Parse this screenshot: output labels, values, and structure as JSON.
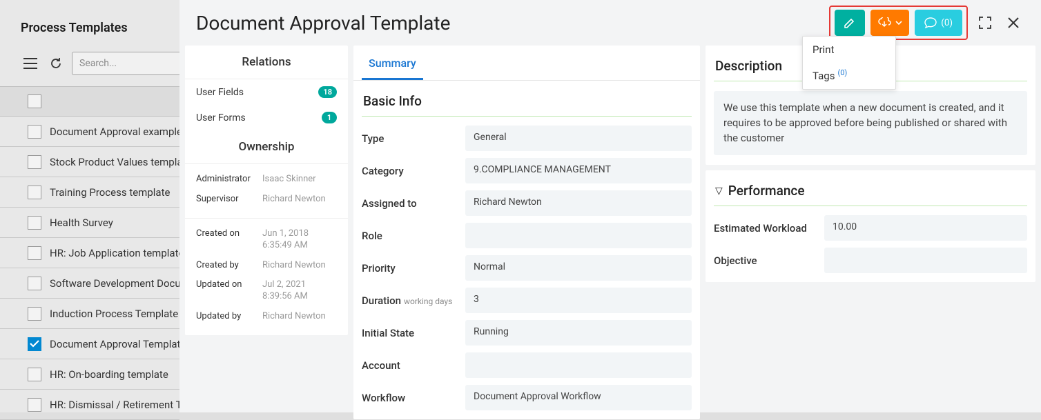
{
  "sidebar": {
    "title": "Process Templates",
    "search_placeholder": "Search...",
    "items": [
      {
        "label": "Document Approval example",
        "checked": false
      },
      {
        "label": "Stock Product Values template",
        "checked": false
      },
      {
        "label": "Training Process template",
        "checked": false
      },
      {
        "label": "Health Survey",
        "checked": false
      },
      {
        "label": "HR: Job Application template",
        "checked": false
      },
      {
        "label": "Software Development Document",
        "checked": false
      },
      {
        "label": "Induction Process Template",
        "checked": false
      },
      {
        "label": "Document Approval Template",
        "checked": true
      },
      {
        "label": "HR: On-boarding template",
        "checked": false
      },
      {
        "label": "HR: Dismissal / Retirement Template",
        "checked": false
      }
    ]
  },
  "main": {
    "title": "Document Approval Template",
    "chat_count": "(0)",
    "tabs": {
      "summary": "Summary"
    },
    "dropdown": {
      "print": "Print",
      "tags": "Tags",
      "tags_count": "(0)"
    }
  },
  "relations": {
    "header": "Relations",
    "items": [
      {
        "label": "User Fields",
        "count": "18"
      },
      {
        "label": "User Forms",
        "count": "1"
      }
    ]
  },
  "ownership": {
    "header": "Ownership",
    "rows": [
      {
        "label": "Administrator",
        "value": "Isaac Skinner"
      },
      {
        "label": "Supervisor",
        "value": "Richard Newton"
      }
    ],
    "rows2": [
      {
        "label": "Created on",
        "value": "Jun 1, 2018 6:35:49 AM"
      },
      {
        "label": "Created by",
        "value": "Richard Newton"
      },
      {
        "label": "Updated on",
        "value": "Jul 2, 2021 8:39:56 AM"
      },
      {
        "label": "Updated by",
        "value": "Richard Newton"
      }
    ]
  },
  "basic_info": {
    "header": "Basic Info",
    "fields": {
      "type_label": "Type",
      "type_value": "General",
      "category_label": "Category",
      "category_value": "9.COMPLIANCE MANAGEMENT",
      "assigned_label": "Assigned to",
      "assigned_value": "Richard Newton",
      "role_label": "Role",
      "role_value": "",
      "priority_label": "Priority",
      "priority_value": "Normal",
      "duration_label": "Duration",
      "duration_sub": "working days",
      "duration_value": "3",
      "initial_label": "Initial State",
      "initial_value": "Running",
      "account_label": "Account",
      "account_value": "",
      "workflow_label": "Workflow",
      "workflow_value": "Document Approval Workflow"
    }
  },
  "description": {
    "header": "Description",
    "text": "We use this template when a new document is created, and it requires to be approved before being published or shared with the customer"
  },
  "performance": {
    "header": "Performance",
    "fields": {
      "workload_label": "Estimated Workload",
      "workload_value": "10.00",
      "objective_label": "Objective",
      "objective_value": ""
    }
  }
}
